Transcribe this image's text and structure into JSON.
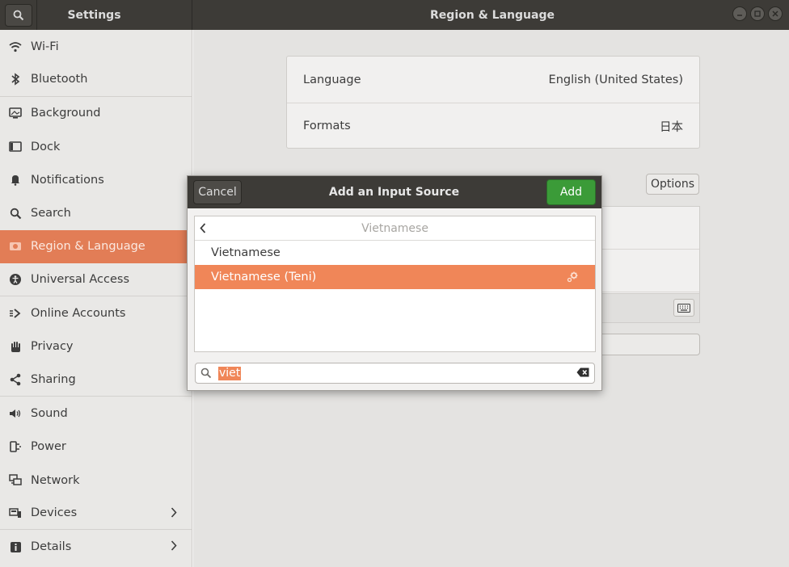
{
  "header": {
    "left_title": "Settings",
    "main_title": "Region & Language"
  },
  "sidebar": {
    "items": [
      {
        "label": "Wi-Fi",
        "icon": "wifi-icon"
      },
      {
        "label": "Bluetooth",
        "icon": "bluetooth-icon"
      },
      {
        "label": "Background",
        "icon": "background-icon"
      },
      {
        "label": "Dock",
        "icon": "dock-icon"
      },
      {
        "label": "Notifications",
        "icon": "bell-icon"
      },
      {
        "label": "Search",
        "icon": "search-icon"
      },
      {
        "label": "Region & Language",
        "icon": "region-icon",
        "active": true
      },
      {
        "label": "Universal Access",
        "icon": "accessibility-icon"
      },
      {
        "label": "Online Accounts",
        "icon": "online-accounts-icon"
      },
      {
        "label": "Privacy",
        "icon": "hand-icon"
      },
      {
        "label": "Sharing",
        "icon": "share-icon"
      },
      {
        "label": "Sound",
        "icon": "speaker-icon"
      },
      {
        "label": "Power",
        "icon": "power-plug-icon"
      },
      {
        "label": "Network",
        "icon": "network-icon"
      },
      {
        "label": "Devices",
        "icon": "devices-icon",
        "chevron": true
      },
      {
        "label": "Details",
        "icon": "info-icon",
        "chevron": true
      }
    ]
  },
  "main": {
    "language_label": "Language",
    "language_value": "English (United States)",
    "formats_label": "Formats",
    "formats_value": "日本",
    "options_label": "Options"
  },
  "dialog": {
    "title": "Add an Input Source",
    "cancel_label": "Cancel",
    "add_label": "Add",
    "list_header": "Vietnamese",
    "rows": [
      {
        "label": "Vietnamese",
        "selected": false
      },
      {
        "label": "Vietnamese (Teni)",
        "selected": true
      }
    ],
    "search_value": "viet"
  },
  "colors": {
    "accent": "#e27d56",
    "selection": "#f08658",
    "add_button": "#3b9b38",
    "headerbar": "#3d3b37"
  }
}
